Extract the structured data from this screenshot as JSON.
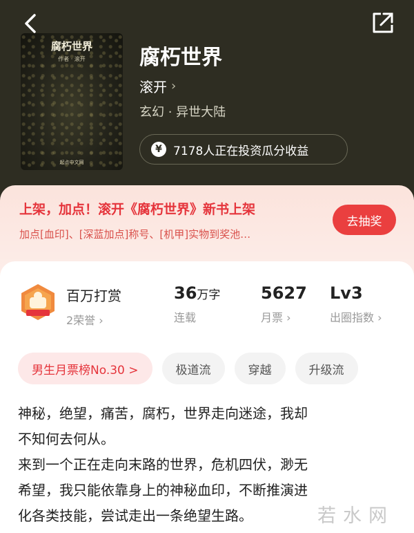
{
  "nav": {
    "back_icon": "chevron-left-icon",
    "share_icon": "share-icon"
  },
  "cover": {
    "title": "腐朽世界",
    "author_line": "作者 · 滚开",
    "publisher": "起点中文网"
  },
  "book": {
    "title": "腐朽世界",
    "author": "滚开",
    "genre": "玄幻 · 异世大陆",
    "invest_text": "7178人正在投资瓜分收益",
    "invest_icon": "yen-coin-icon"
  },
  "promo": {
    "title": "上架，加点！滚开《腐朽世界》新书上架",
    "subtitle": "加点[血印]、[深蓝加点]称号、[机甲]实物到奖池…",
    "button": "去抽奖"
  },
  "award": {
    "name": "百万打赏",
    "sub": "2荣誉",
    "badge_text": "百万打赏"
  },
  "stats": {
    "words": {
      "value": "36",
      "unit": "万字",
      "label": "连载"
    },
    "tickets": {
      "value": "5627",
      "label": "月票"
    },
    "level": {
      "value": "Lv3",
      "label": "出圈指数"
    }
  },
  "tags": [
    "男生月票榜No.30 >",
    "极道流",
    "穿越",
    "升级流"
  ],
  "synopsis": [
    "神秘，绝望，痛苦，腐朽，世界走向迷途，我却",
    "不知何去何从。",
    "来到一个正在走向末路的世界，危机四伏，渺无",
    "希望，我只能依靠身上的神秘血印，不断推演进",
    "化各类技能，尝试走出一条绝望生路。"
  ],
  "watermark": "若水网",
  "colors": {
    "header_bg": "#2e2d22",
    "accent_red": "#e5343b",
    "promo_bg": "#fbe3dc"
  }
}
